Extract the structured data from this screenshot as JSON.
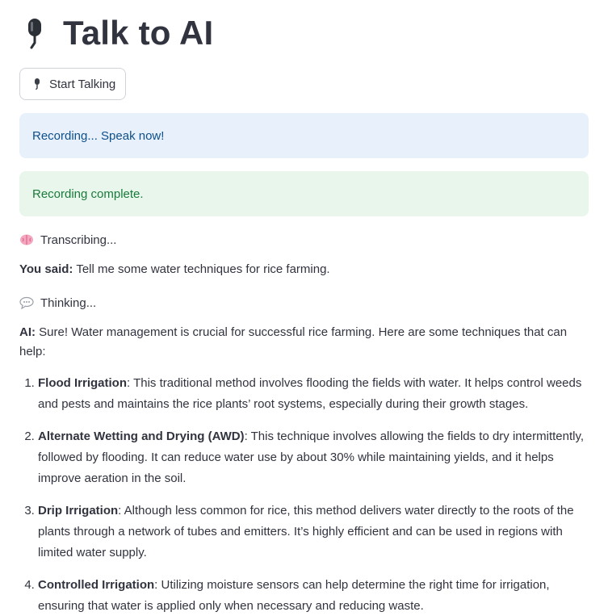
{
  "header": {
    "title": "Talk to AI",
    "icon": "microphone-icon"
  },
  "controls": {
    "start_button_label": "Start Talking",
    "start_button_icon": "microphone-icon"
  },
  "alerts": {
    "recording": "Recording... Speak now!",
    "complete": "Recording complete."
  },
  "status": {
    "transcribing": "Transcribing...",
    "transcribing_icon": "brain-icon",
    "thinking": "Thinking...",
    "thinking_icon": "speech-bubble-icon"
  },
  "conversation": {
    "user_label": "You said:",
    "user_text": "Tell me some water techniques for rice farming.",
    "ai_label": "AI:",
    "ai_intro": "Sure! Water management is crucial for successful rice farming. Here are some techniques that can help:",
    "techniques": [
      {
        "name": "Flood Irrigation",
        "text": ": This traditional method involves flooding the fields with water. It helps control weeds and pests and maintains the rice plants’ root systems, especially during their growth stages."
      },
      {
        "name": "Alternate Wetting and Drying (AWD)",
        "text": ": This technique involves allowing the fields to dry intermittently, followed by flooding. It can reduce water use by about 30% while maintaining yields, and it helps improve aeration in the soil."
      },
      {
        "name": "Drip Irrigation",
        "text": ": Although less common for rice, this method delivers water directly to the roots of the plants through a network of tubes and emitters. It’s highly efficient and can be used in regions with limited water supply."
      },
      {
        "name": "Controlled Irrigation",
        "text": ": Utilizing moisture sensors can help determine the right time for irrigation, ensuring that water is applied only when necessary and reducing waste."
      }
    ]
  },
  "colors": {
    "info_bg": "#e8f1fb",
    "info_text": "#0e4f8a",
    "success_bg": "#e8f6ec",
    "success_text": "#1b7a3b",
    "text": "#31333f"
  }
}
